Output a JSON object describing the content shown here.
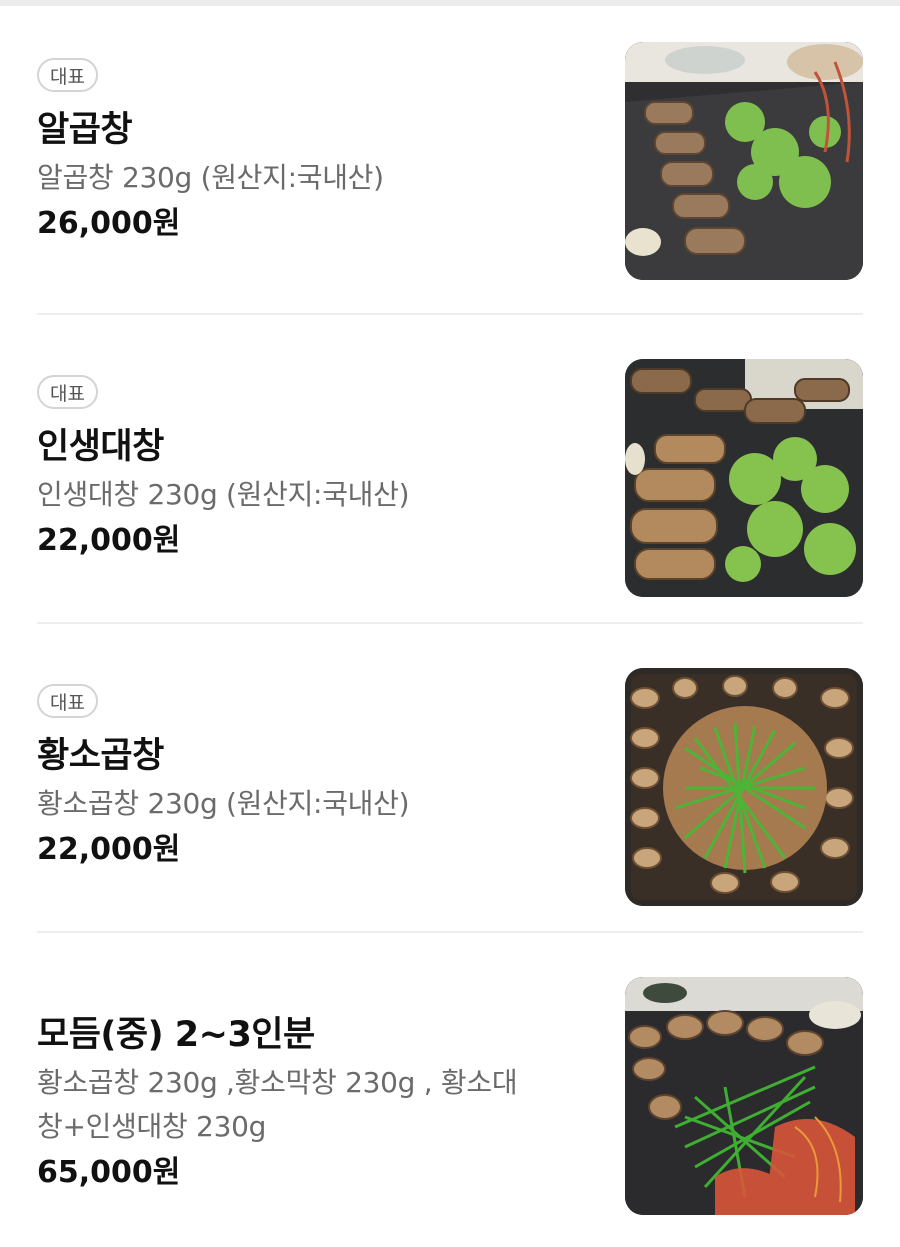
{
  "menu": {
    "items": [
      {
        "badge": "대표",
        "name": "알곱창",
        "description": "알곱창 230g (원산지:국내산)",
        "price": "26,000원",
        "image_icon": "grilled-intestine-photo"
      },
      {
        "badge": "대표",
        "name": "인생대창",
        "description": "인생대창 230g (원산지:국내산)",
        "price": "22,000원",
        "image_icon": "grilled-intestine-photo"
      },
      {
        "badge": "대표",
        "name": "황소곱창",
        "description": "황소곱창 230g (원산지:국내산)",
        "price": "22,000원",
        "image_icon": "grilled-intestine-chives-photo"
      },
      {
        "name": "모듬(중) 2~3인분",
        "description_line1": "황소곱창 230g ,황소막창 230g , 황소대",
        "description_line2": "창+인생대창 230g",
        "price": "65,000원",
        "image_icon": "assorted-grill-photo"
      }
    ]
  }
}
